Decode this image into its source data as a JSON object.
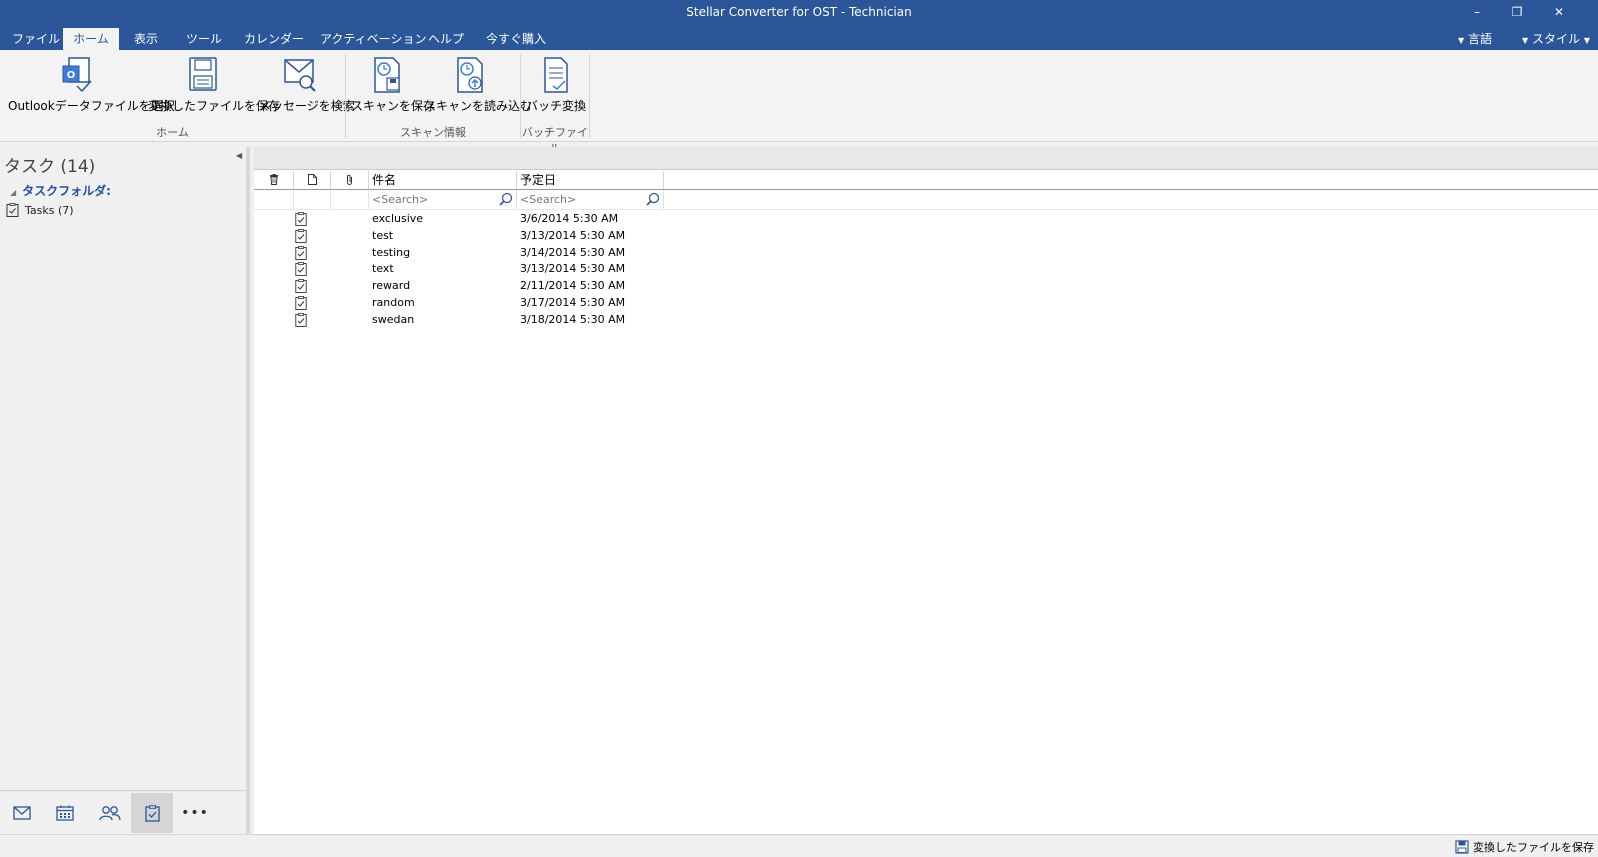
{
  "titlebar": {
    "title": "Stellar Converter for OST - Technician",
    "minimize": "–",
    "restore": "❐",
    "close": "✕"
  },
  "menubar": {
    "tabs": [
      "ファイル",
      "ホーム",
      "表示",
      "ツール",
      "カレンダー",
      "アクティベーション",
      "ヘルプ",
      "今すぐ購入"
    ],
    "active_tab": "ホーム",
    "language": "言語",
    "style": "スタイル"
  },
  "ribbon": {
    "buttons": {
      "select_file": "Outlookデータファイルを選択",
      "save_converted": "変換したファイルを保存",
      "search_message": "メッセージを検索",
      "save_scan": "スキャンを保存",
      "load_scan": "スキャンを読み込む",
      "batch": "バッチ変換"
    },
    "groups": {
      "home": "ホーム",
      "scan_info": "スキャン情報",
      "batch_file": "バッチファイル"
    }
  },
  "sidebar": {
    "header": "タスク (14)",
    "folder_root": "タスクフォルダ:",
    "folder_item": "Tasks (7)",
    "nav_icons": [
      "mail-icon",
      "calendar-icon",
      "contacts-icon",
      "tasks-icon",
      "more-icon"
    ],
    "more_label": "•••"
  },
  "table": {
    "columns": {
      "subject": "件名",
      "due": "予定日"
    },
    "search_placeholder": "<Search>",
    "rows": [
      {
        "subject": "exclusive",
        "due": "3/6/2014 5:30 AM"
      },
      {
        "subject": "test",
        "due": "3/13/2014 5:30 AM"
      },
      {
        "subject": "testing",
        "due": "3/14/2014 5:30 AM"
      },
      {
        "subject": "text",
        "due": "3/13/2014 5:30 AM"
      },
      {
        "subject": "reward",
        "due": "2/11/2014 5:30 AM"
      },
      {
        "subject": "random",
        "due": "3/17/2014 5:30 AM"
      },
      {
        "subject": "swedan",
        "due": "3/18/2014 5:30 AM"
      }
    ]
  },
  "statusbar": {
    "save_label": "変換したファイルを保存"
  },
  "colors": {
    "accent": "#2b579a",
    "link_blue": "#1e50a2"
  }
}
